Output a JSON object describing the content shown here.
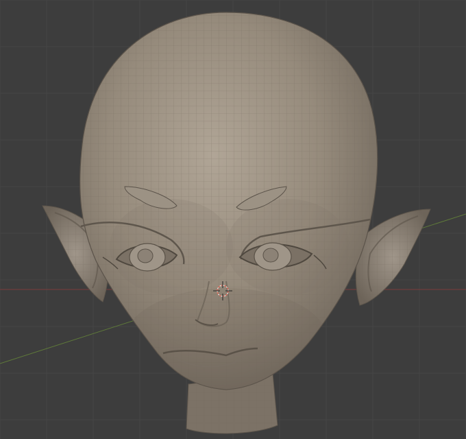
{
  "viewport": {
    "background": "#3d3d3d",
    "grid_color": "#454545",
    "x_axis_color": "#7a3a3a",
    "y_axis_color": "#5f7a3a",
    "icons": [
      "3d-cursor-icon"
    ]
  },
  "model": {
    "mesh_color": "#8f8476",
    "wire_color": "#6e655a",
    "highlight_color": "#b0a596"
  }
}
